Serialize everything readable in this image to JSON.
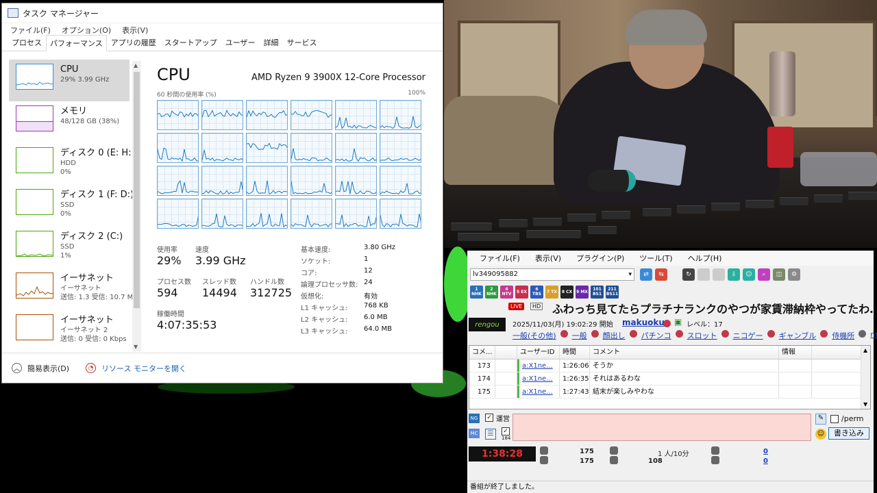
{
  "taskmanager": {
    "title": "タスク マネージャー",
    "menu": [
      "ファイル(F)",
      "オプション(O)",
      "表示(V)"
    ],
    "tabs": [
      "プロセス",
      "パフォーマンス",
      "アプリの履歴",
      "スタートアップ",
      "ユーザー",
      "詳細",
      "サービス"
    ],
    "active_tab": "パフォーマンス",
    "sidebar": [
      {
        "name": "CPU",
        "line1": "29%  3.99 GHz",
        "line2": "",
        "line3": ""
      },
      {
        "name": "メモリ",
        "line1": "48/128 GB (38%)",
        "line2": "",
        "line3": ""
      },
      {
        "name": "ディスク 0 (E: H:)",
        "line1": "HDD",
        "line2": "0%",
        "line3": ""
      },
      {
        "name": "ディスク 1 (F: D:)",
        "line1": "SSD",
        "line2": "0%",
        "line3": ""
      },
      {
        "name": "ディスク 2 (C:)",
        "line1": "SSD",
        "line2": "1%",
        "line3": ""
      },
      {
        "name": "イーサネット",
        "line1": "イーサネット",
        "line2": "送信: 1.3  受信: 10.7 M",
        "line3": ""
      },
      {
        "name": "イーサネット",
        "line1": "イーサネット 2",
        "line2": "送信: 0  受信: 0 Kbps",
        "line3": ""
      }
    ],
    "main": {
      "heading": "CPU",
      "processor": "AMD Ryzen 9 3900X 12-Core Processor",
      "graph_caption": "60 秒間の使用率 (%)",
      "graph_max": "100%",
      "usage_label": "使用率",
      "usage": "29%",
      "speed_label": "速度",
      "speed": "3.99 GHz",
      "proc_label": "プロセス数",
      "procs": "594",
      "threads_label": "スレッド数",
      "threads": "14494",
      "handles_label": "ハンドル数",
      "handles": "312725",
      "uptime_label": "稼働時間",
      "uptime": "4:07:35:53",
      "details": [
        {
          "k": "基本速度:",
          "v": "3.80 GHz"
        },
        {
          "k": "ソケット:",
          "v": "1"
        },
        {
          "k": "コア:",
          "v": "12"
        },
        {
          "k": "論理プロセッサ数:",
          "v": "24"
        },
        {
          "k": "仮想化:",
          "v": "有効"
        },
        {
          "k": "L1 キャッシュ:",
          "v": "768 KB"
        },
        {
          "k": "L2 キャッシュ:",
          "v": "6.0 MB"
        },
        {
          "k": "L3 キャッシュ:",
          "v": "64.0 MB"
        }
      ]
    },
    "footer": {
      "simple": "簡易表示(D)",
      "resmon": "リソース モニターを開く"
    }
  },
  "viewer": {
    "menu": [
      "ファイル(F)",
      "表示(V)",
      "プラグイン(P)",
      "ツール(T)",
      "ヘルプ(H)"
    ],
    "live_id": "lv349095882",
    "channels": [
      "1 NHK",
      "2 NHK",
      "4 NTV",
      "5 EX",
      "6 TBS",
      "7 TX",
      "8 CX",
      "9 MX",
      "101 BS1",
      "211 BS11"
    ],
    "badge_live": "LIVE",
    "badge_hd": "HD",
    "title": "ふわっち見てたらプラチナランクのやつが家賃滞納枠やってたわ…あ",
    "logo": "rengou",
    "start": "2025/11/03(月) 19:02:29 開始",
    "owner": "makuoku",
    "level": "レベル：17",
    "tags": [
      "一般(その他)",
      "一般",
      "顔出し",
      "パチンコ",
      "スロット",
      "ニコゲー",
      "ギャンブル",
      "侍機所",
      "ma"
    ],
    "columns": [
      "コメ...",
      "",
      "ユーザーID",
      "時間",
      "コメント",
      "情報"
    ],
    "rows": [
      {
        "no": "173",
        "user": "a:X1ne...",
        "time": "1:26:06",
        "comment": "そうか"
      },
      {
        "no": "174",
        "user": "a:X1ne...",
        "time": "1:26:35",
        "comment": "それはあるわな"
      },
      {
        "no": "175",
        "user": "a:X1ne...",
        "time": "1:27:43",
        "comment": "結末が楽しみやわな"
      }
    ],
    "post": {
      "ng": "NG",
      "unei": "運営",
      "perm": "/perm",
      "write": "書き込み",
      "n184": "184"
    },
    "elapsed": "1:38:28",
    "counts": {
      "c1": "175",
      "c2": "175",
      "viewers": "1 人/10分",
      "viewers2": "108",
      "link1": "0",
      "link2": "0"
    },
    "status": "番組が終了しました。"
  }
}
